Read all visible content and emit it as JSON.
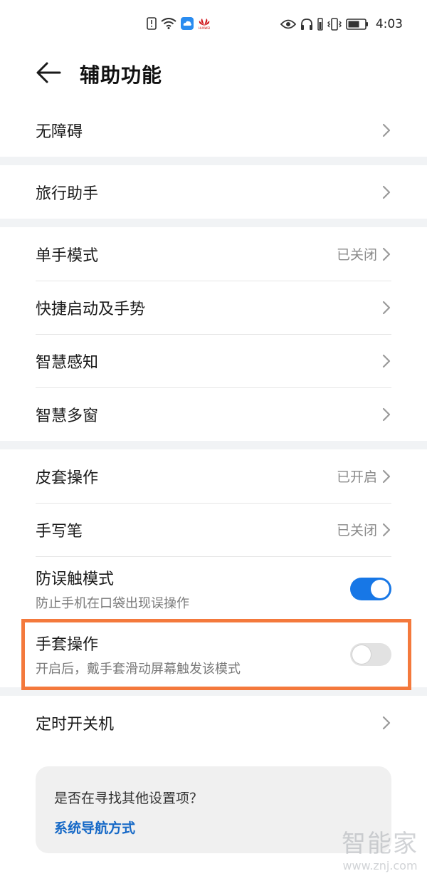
{
  "status_bar": {
    "time": "4:03",
    "left_icons": [
      "alert-icon",
      "wifi-icon",
      "cloud-icon",
      "huawei-logo"
    ],
    "huawei_text": "HUAWEI",
    "right_icons": [
      "eye-icon",
      "headphone-icon",
      "signal-icon",
      "vibrate-icon",
      "battery-icon"
    ]
  },
  "header": {
    "title": "辅助功能"
  },
  "groups": {
    "g1": {
      "row1": {
        "title": "无障碍"
      }
    },
    "g2": {
      "row1": {
        "title": "旅行助手"
      }
    },
    "g3": {
      "row1": {
        "title": "单手模式",
        "value": "已关闭"
      },
      "row2": {
        "title": "快捷启动及手势"
      },
      "row3": {
        "title": "智慧感知"
      },
      "row4": {
        "title": "智慧多窗"
      }
    },
    "g4": {
      "row1": {
        "title": "皮套操作",
        "value": "已开启"
      },
      "row2": {
        "title": "手写笔",
        "value": "已关闭"
      },
      "row3": {
        "title": "防误触模式",
        "subtitle": "防止手机在口袋出现误操作",
        "toggle_on": true
      },
      "row4": {
        "title": "手套操作",
        "subtitle": "开启后，戴手套滑动屏幕触发该模式",
        "toggle_on": false
      }
    },
    "g5": {
      "row1": {
        "title": "定时开关机"
      }
    }
  },
  "hint_card": {
    "question": "是否在寻找其他设置项？",
    "link": "系统导航方式"
  },
  "watermark": {
    "logo": "智能家",
    "url": "www.znj.com"
  },
  "colors": {
    "accent": "#1777e6",
    "highlight": "#f4793c",
    "link": "#1669c7",
    "separator": "#f1f3f5"
  }
}
